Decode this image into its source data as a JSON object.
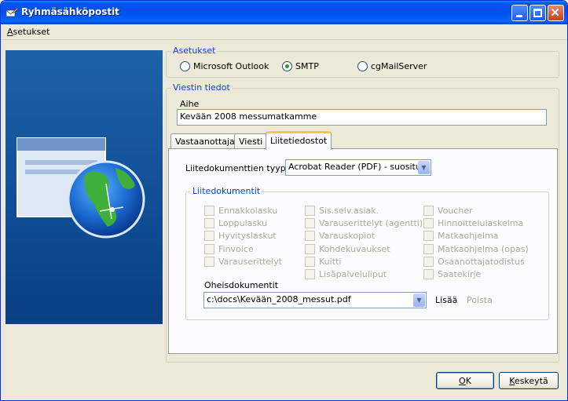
{
  "window": {
    "title": "Ryhmäsähköpostit"
  },
  "menu": {
    "items": [
      "Asetukset"
    ]
  },
  "settings": {
    "legend": "Asetukset",
    "options": [
      "Microsoft Outlook",
      "SMTP",
      "cgMailServer"
    ],
    "selected": "SMTP"
  },
  "message": {
    "legend": "Viestin tiedot",
    "subject_label": "Aihe",
    "subject_value": "Kevään 2008 messumatkamme"
  },
  "tabs": [
    "Vastaanottajat",
    "Viesti",
    "Liitetiedostot"
  ],
  "active_tab": "Liitetiedostot",
  "attachments": {
    "type_label": "Liitedokumenttien tyyppi",
    "type_value": "Acrobat Reader (PDF) - suositus",
    "docs_legend": "Liitedokumentit",
    "col1": [
      "Ennakkolasku",
      "Loppulasku",
      "Hyvityslaskut",
      "Finvoice",
      "Varauserittelyt"
    ],
    "col2": [
      "Sis.selv.asiak.",
      "Varauserittelyt (agentti)",
      "Varauskopiot",
      "Kohdekuvaukset",
      "Kuitti",
      "Lisäpalveluliput"
    ],
    "col3": [
      "Voucher",
      "Hinnoittelulaskelma",
      "Matkaohjelma",
      "Matkaohjelma (opas)",
      "Osaanottajatodistus",
      "Saatekirje"
    ],
    "other_label": "Oheisdokumentit",
    "other_value": "c:\\docs\\Kevään_2008_messut.pdf",
    "add_label": "Lisää",
    "remove_label": "Poista"
  },
  "buttons": {
    "ok": "OK",
    "cancel": "Keskeytä"
  }
}
